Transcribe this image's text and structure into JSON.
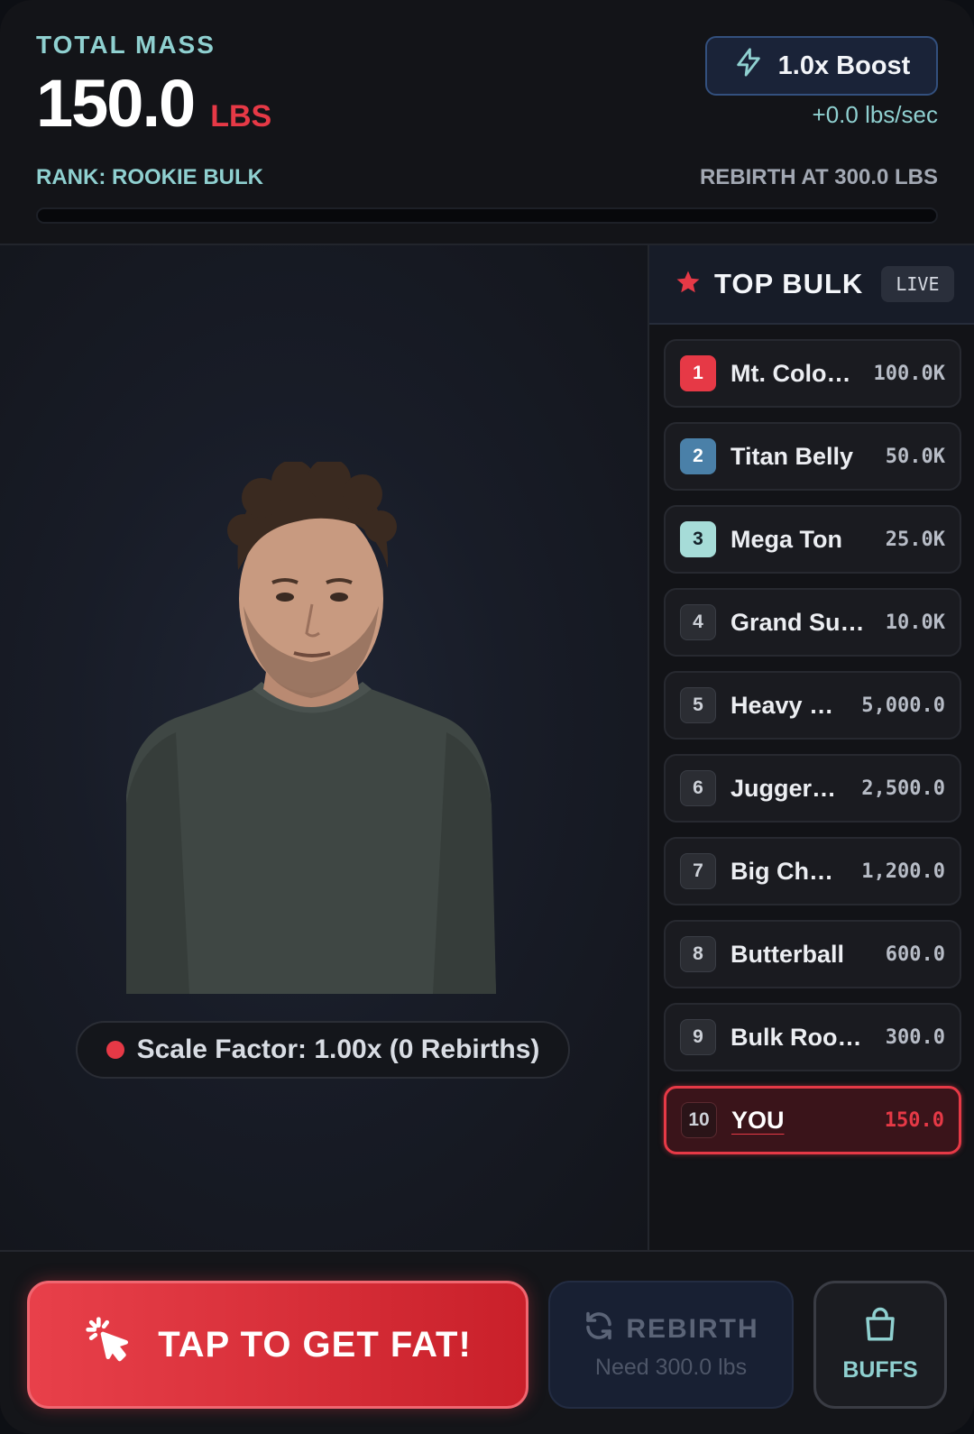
{
  "header": {
    "mass_label": "TOTAL MASS",
    "mass_value": "150.0",
    "mass_unit": "LBS",
    "boost_label": "1.0x Boost",
    "rate": "+0.0 lbs/sec",
    "rank": "RANK: ROOKIE BULK",
    "rebirth_at": "REBIRTH AT 300.0 LBS",
    "progress_fraction": 0.0
  },
  "stage": {
    "scale_text": "Scale Factor: 1.00x (0 Rebirths)"
  },
  "leaderboard": {
    "title": "TOP BULK",
    "live": "LIVE",
    "players": [
      {
        "rank": "1",
        "name": "Mt. Colo…",
        "score": "100.0K"
      },
      {
        "rank": "2",
        "name": "Titan Belly",
        "score": "50.0K"
      },
      {
        "rank": "3",
        "name": "Mega Ton",
        "score": "25.0K"
      },
      {
        "rank": "4",
        "name": "Grand Su…",
        "score": "10.0K"
      },
      {
        "rank": "5",
        "name": "Heavy …",
        "score": "5,000.0"
      },
      {
        "rank": "6",
        "name": "Jugger…",
        "score": "2,500.0"
      },
      {
        "rank": "7",
        "name": "Big Ch…",
        "score": "1,200.0"
      },
      {
        "rank": "8",
        "name": "Butterball",
        "score": "600.0"
      },
      {
        "rank": "9",
        "name": "Bulk Rookie",
        "score": "300.0"
      },
      {
        "rank": "10",
        "name": "YOU",
        "score": "150.0"
      }
    ]
  },
  "actions": {
    "tap_label": "TAP TO GET FAT!",
    "rebirth_label": "REBIRTH",
    "rebirth_sub": "Need 300.0 lbs",
    "buffs_label": "BUFFS"
  },
  "colors": {
    "accent": "#e63946",
    "teal": "#8fd0d0",
    "rank2": "#4a80a8",
    "rank3": "#a6dcd8"
  }
}
